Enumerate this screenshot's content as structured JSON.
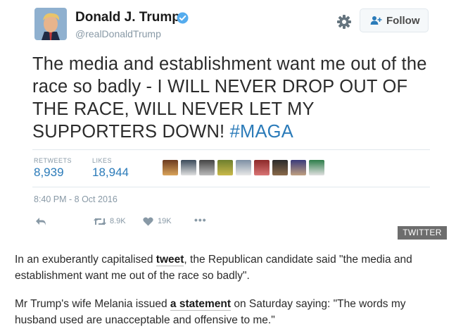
{
  "tweet": {
    "author_name": "Donald J. Trump",
    "handle": "@realDonaldTrump",
    "follow_label": "Follow",
    "text_main": "The media and establishment want me out of the race so badly -  I WILL NEVER DROP OUT OF THE RACE, WILL NEVER LET MY SUPPORTERS DOWN! ",
    "hashtag": "#MAGA",
    "retweets_label": "RETWEETS",
    "retweets_value": "8,939",
    "likes_label": "LIKES",
    "likes_value": "18,944",
    "timestamp": "8:40 PM - 8 Oct 2016",
    "action_retweet_count": "8.9K",
    "action_like_count": "19K",
    "verified_color": "#55acee",
    "link_color": "#2b7bb9"
  },
  "credit": "TWITTER",
  "article": {
    "p1_before": "In an exuberantly capitalised ",
    "p1_link": "tweet",
    "p1_after": ", the Republican candidate said \"the media and establishment want me out of the race so badly\".",
    "p2_before": "Mr Trump's wife Melania issued ",
    "p2_link": "a statement",
    "p2_after": " on Saturday saying: \"The words my husband used are unacceptable and offensive to me.\""
  }
}
